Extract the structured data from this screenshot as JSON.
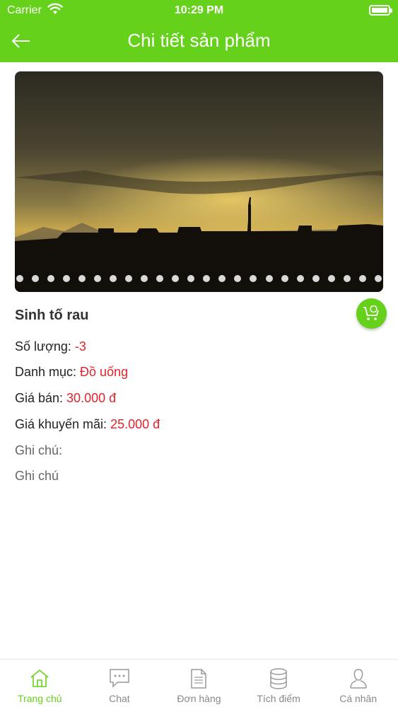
{
  "status_bar": {
    "carrier": "Carrier",
    "time": "10:29 PM"
  },
  "header": {
    "title": "Chi tiết sản phẩm",
    "color": "#66d11a"
  },
  "product": {
    "name": "Sinh tố rau",
    "carousel_dot_count": 24,
    "quantity_label": "Số lượng: ",
    "quantity_value": "-3",
    "category_label": "Danh mục: ",
    "category_value": "Đồ uống",
    "price_label": "Giá bán: ",
    "price_value": "30.000 đ",
    "promo_label": "Giá khuyến mãi: ",
    "promo_value": "25.000 đ",
    "note_label": "Ghi chú:",
    "note_value": "Ghi chú"
  },
  "cart": {
    "icon": "cart-icon"
  },
  "tabbar": {
    "tabs": [
      {
        "label": "Trang chủ",
        "icon": "home-icon",
        "active": true
      },
      {
        "label": "Chat",
        "icon": "chat-icon",
        "active": false
      },
      {
        "label": "Đơn hàng",
        "icon": "document-icon",
        "active": false
      },
      {
        "label": "Tích điểm",
        "icon": "database-icon",
        "active": false
      },
      {
        "label": "Cá nhân",
        "icon": "person-icon",
        "active": false
      }
    ]
  },
  "accent_red": "#e0242b"
}
